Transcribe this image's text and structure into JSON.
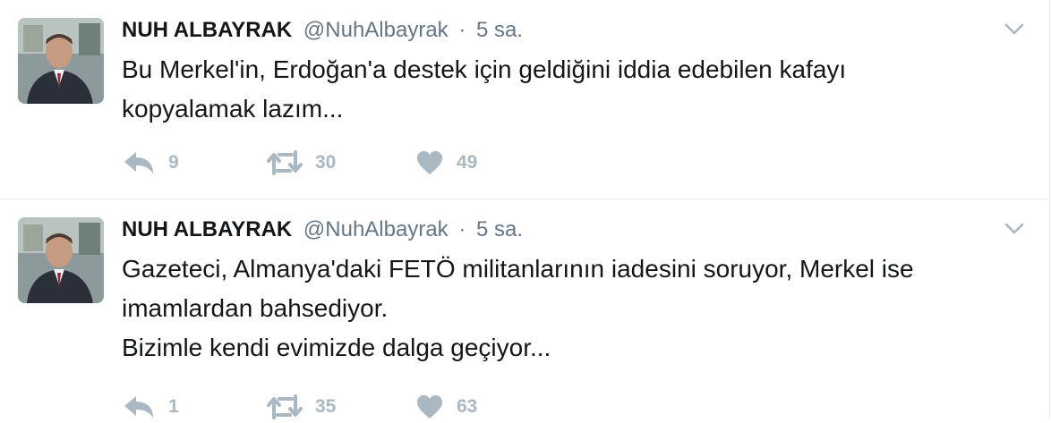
{
  "tweets": [
    {
      "fullname": "NUH ALBAYRAK",
      "username": "@NuhAlbayrak",
      "separator": "·",
      "time": "5 sa.",
      "lines": [
        "Bu Merkel'in, Erdoğan'a destek için geldiğini iddia edebilen kafayı",
        "kopyalamak lazım..."
      ],
      "replies": "9",
      "retweets": "30",
      "likes": "49"
    },
    {
      "fullname": "NUH ALBAYRAK",
      "username": "@NuhAlbayrak",
      "separator": "·",
      "time": "5 sa.",
      "lines": [
        "Gazeteci, Almanya'daki FETÖ militanlarının iadesini soruyor, Merkel ise",
        "imamlardan bahsediyor.",
        "Bizimle kendi evimizde dalga geçiyor..."
      ],
      "replies": "1",
      "retweets": "35",
      "likes": "63"
    }
  ],
  "colors": {
    "text": "#14171a",
    "secondary": "#657786",
    "action_icon": "#aab8c2",
    "divider": "#e6ecf0"
  },
  "icons": {
    "reply": "reply-arrow-icon",
    "retweet": "retweet-icon",
    "like": "heart-icon",
    "menu": "chevron-down-icon"
  }
}
